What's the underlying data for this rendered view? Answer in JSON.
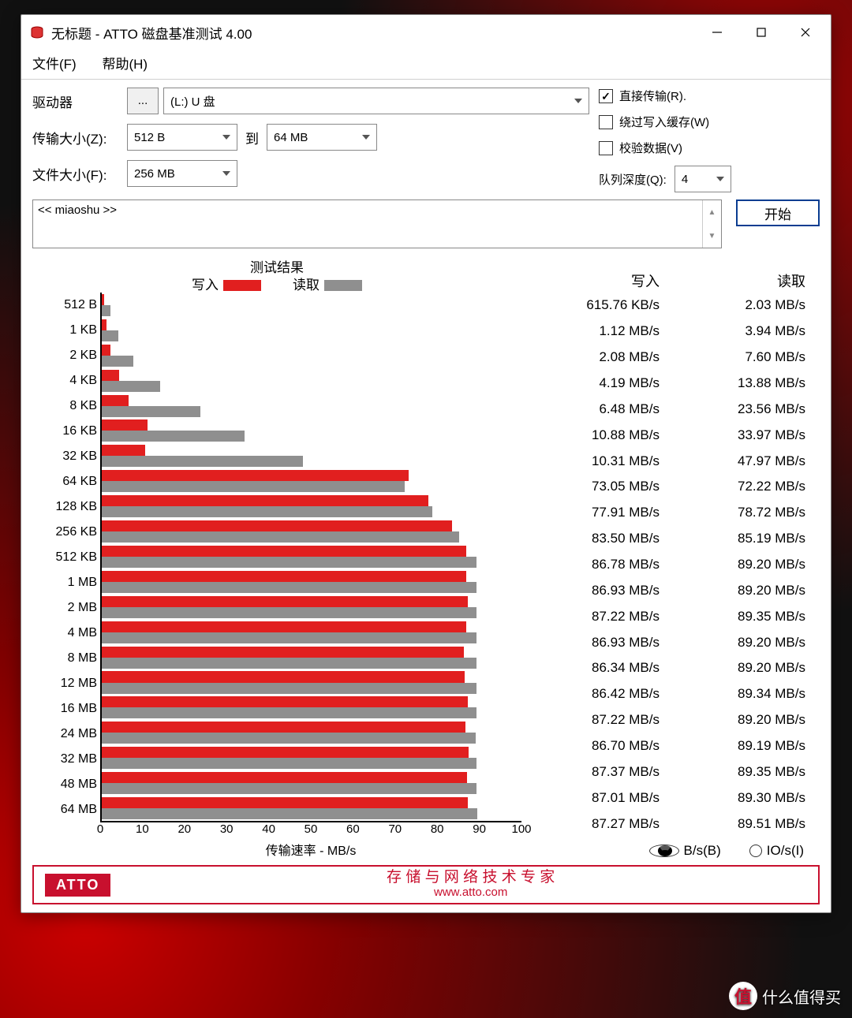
{
  "title": "无标题 - ATTO 磁盘基准测试 4.00",
  "menu": {
    "file": "文件(F)",
    "help": "帮助(H)"
  },
  "labels": {
    "drive": "驱动器",
    "drive_browse": "...",
    "transfer_size": "传输大小(Z):",
    "to": "到",
    "file_size": "文件大小(F):",
    "direct_io": "直接传输(R).",
    "bypass_cache": "绕过写入缓存(W)",
    "verify": "校验数据(V)",
    "queue_depth": "队列深度(Q):",
    "start": "开始",
    "desc": "<< miaoshu >>",
    "results_title": "测试结果",
    "legend_write": "写入",
    "legend_read": "读取",
    "xlabel": "传输速率 - MB/s",
    "col_write": "写入",
    "col_read": "读取",
    "radio_bs": "B/s(B)",
    "radio_ios": "IO/s(I)"
  },
  "values": {
    "drive": "(L:) U 盘",
    "ts_from": "512 B",
    "ts_to": "64 MB",
    "file_size": "256 MB",
    "queue_depth": "4",
    "direct_io_checked": true,
    "bypass_cache_checked": false,
    "verify_checked": false,
    "unit_mode": "bs"
  },
  "footer": {
    "brand": "ATTO",
    "tagline": "存 储 与 网 络 技 术 专 家",
    "url": "www.atto.com"
  },
  "watermark": "什么值得买",
  "chart_data": {
    "type": "bar",
    "title": "测试结果",
    "xlabel": "传输速率 - MB/s",
    "ylabel": "",
    "xlim": [
      0,
      100
    ],
    "xticks": [
      0,
      10,
      20,
      30,
      40,
      50,
      60,
      70,
      80,
      90,
      100
    ],
    "categories": [
      "512 B",
      "1 KB",
      "2 KB",
      "4 KB",
      "8 KB",
      "16 KB",
      "32 KB",
      "64 KB",
      "128 KB",
      "256 KB",
      "512 KB",
      "1 MB",
      "2 MB",
      "4 MB",
      "8 MB",
      "12 MB",
      "16 MB",
      "24 MB",
      "32 MB",
      "48 MB",
      "64 MB"
    ],
    "series": [
      {
        "name": "写入",
        "color": "#e11f1f",
        "values_mbps": [
          0.6,
          1.12,
          2.08,
          4.19,
          6.48,
          10.88,
          10.31,
          73.05,
          77.91,
          83.5,
          86.78,
          86.93,
          87.22,
          86.93,
          86.34,
          86.42,
          87.22,
          86.7,
          87.37,
          87.01,
          87.27
        ],
        "display": [
          "615.76 KB/s",
          "1.12 MB/s",
          "2.08 MB/s",
          "4.19 MB/s",
          "6.48 MB/s",
          "10.88 MB/s",
          "10.31 MB/s",
          "73.05 MB/s",
          "77.91 MB/s",
          "83.50 MB/s",
          "86.78 MB/s",
          "86.93 MB/s",
          "87.22 MB/s",
          "86.93 MB/s",
          "86.34 MB/s",
          "86.42 MB/s",
          "87.22 MB/s",
          "86.70 MB/s",
          "87.37 MB/s",
          "87.01 MB/s",
          "87.27 MB/s"
        ]
      },
      {
        "name": "读取",
        "color": "#8f8f8f",
        "values_mbps": [
          2.03,
          3.94,
          7.6,
          13.88,
          23.56,
          33.97,
          47.97,
          72.22,
          78.72,
          85.19,
          89.2,
          89.2,
          89.35,
          89.2,
          89.2,
          89.34,
          89.2,
          89.19,
          89.35,
          89.3,
          89.51
        ],
        "display": [
          "2.03 MB/s",
          "3.94 MB/s",
          "7.60 MB/s",
          "13.88 MB/s",
          "23.56 MB/s",
          "33.97 MB/s",
          "47.97 MB/s",
          "72.22 MB/s",
          "78.72 MB/s",
          "85.19 MB/s",
          "89.20 MB/s",
          "89.20 MB/s",
          "89.35 MB/s",
          "89.20 MB/s",
          "89.20 MB/s",
          "89.34 MB/s",
          "89.20 MB/s",
          "89.19 MB/s",
          "89.35 MB/s",
          "89.30 MB/s",
          "89.51 MB/s"
        ]
      }
    ]
  }
}
